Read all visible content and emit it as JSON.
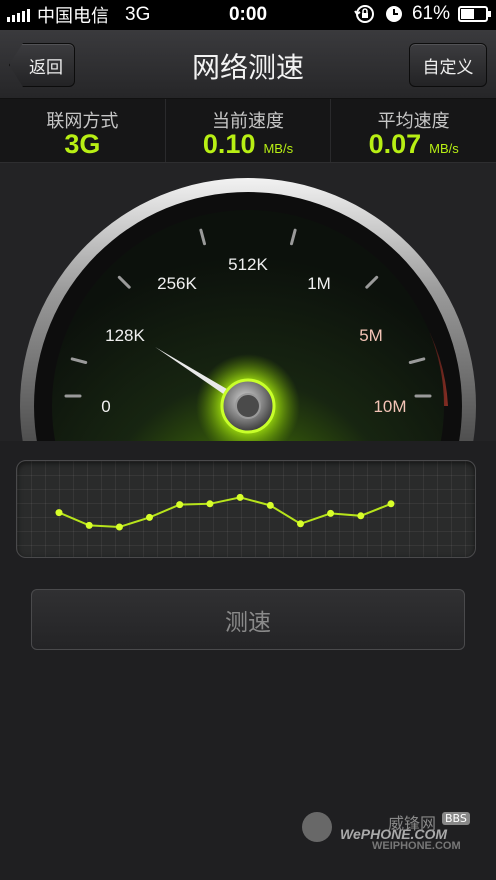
{
  "status_bar": {
    "carrier": "中国电信",
    "network": "3G",
    "time": "0:00",
    "battery_percent_label": "61%",
    "battery_level": 0.61
  },
  "nav": {
    "back_label": "返回",
    "title": "网络测速",
    "custom_label": "自定义"
  },
  "stats": {
    "network_type_label": "联网方式",
    "network_type_value": "3G",
    "current_speed_label": "当前速度",
    "current_speed_value": "0.10",
    "current_speed_unit": "MB/s",
    "avg_speed_label": "平均速度",
    "avg_speed_value": "0.07",
    "avg_speed_unit": "MB/s"
  },
  "gauge": {
    "scale_labels": [
      "0",
      "128K",
      "256K",
      "512K",
      "1M",
      "5M",
      "10M"
    ],
    "needle_value": "128K",
    "needle_fraction": 0.18
  },
  "speed_graph": {
    "values": [
      0.58,
      0.42,
      0.4,
      0.52,
      0.68,
      0.69,
      0.77,
      0.67,
      0.44,
      0.57,
      0.54,
      0.69
    ]
  },
  "test_button_label": "测速",
  "watermark": {
    "brand": "WePHONE.COM",
    "cn": "威锋网",
    "bbs": "BBS",
    "url": "WEIPHONE.COM"
  },
  "colors": {
    "accent": "#b8ef14",
    "graph_line": "#b7e41b"
  }
}
